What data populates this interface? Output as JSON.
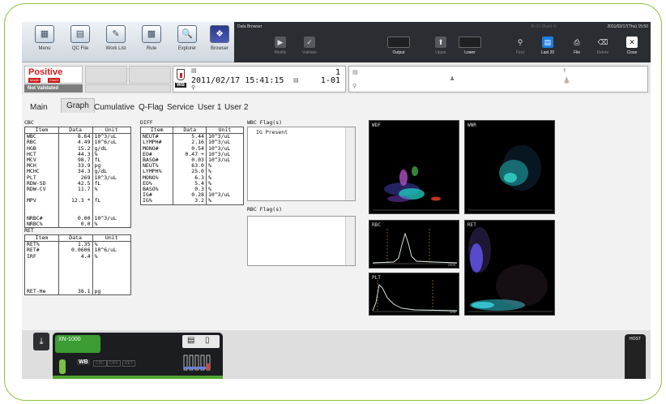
{
  "toolbar": {
    "buttons": [
      {
        "label": "Menu",
        "icon": "menu-icon"
      },
      {
        "label": "QC File",
        "icon": "qc-file-icon"
      },
      {
        "label": "Work List",
        "icon": "work-list-icon"
      },
      {
        "label": "Rule",
        "icon": "rule-icon"
      },
      {
        "label": "Explorer",
        "icon": "explorer-icon"
      },
      {
        "label": "Browser",
        "icon": "browser-icon"
      }
    ]
  },
  "data_browser": {
    "title": "Data Browser",
    "status_right": "2011/02/17(Thu) 15:50",
    "status_mid": "IB-03 (Build 4)",
    "buttons": [
      {
        "label": "Modify",
        "state": "disabled"
      },
      {
        "label": "Validate",
        "state": "disabled"
      },
      {
        "label": "Output",
        "state": "on"
      },
      {
        "label": "Upper",
        "state": "disabled"
      },
      {
        "label": "Lower",
        "state": "on"
      },
      {
        "label": "Find",
        "state": "disabled"
      },
      {
        "label": "Last 20",
        "state": "selected"
      },
      {
        "label": "File",
        "state": "on"
      },
      {
        "label": "Delete",
        "state": "disabled"
      },
      {
        "label": "Close",
        "state": "on"
      }
    ]
  },
  "status": {
    "result": "Positive",
    "tags": [
      "Morph",
      "Count"
    ],
    "validation": "Not Validated"
  },
  "sample": {
    "rack_label": "WB",
    "datetime": "2011/02/17 15:41:15",
    "number_top": "1",
    "number_bottom": "1-01"
  },
  "tabs": [
    "Main",
    "Graph",
    "Cumulative",
    "Q-Flag",
    "Service",
    "User 1",
    "User 2"
  ],
  "active_tab": "Graph",
  "cbc": {
    "title": "CBC",
    "headers": [
      "Item",
      "Data",
      "Unit"
    ],
    "rows": [
      [
        "WBC",
        "8.64",
        "10^3/uL"
      ],
      [
        "RBC",
        "4.49",
        "10^6/uL"
      ],
      [
        "HGB",
        "15.2",
        "g/dL"
      ],
      [
        "HCT",
        "44.3",
        "%"
      ],
      [
        "MCV",
        "98.7",
        "fL"
      ],
      [
        "MCH",
        "33.9",
        "pg"
      ],
      [
        "MCHC",
        "34.3",
        "g/dL"
      ],
      [
        "PLT",
        "269",
        "10^3/uL"
      ],
      [
        "RDW-SD",
        "42.5",
        "fL"
      ],
      [
        "RDW-CV",
        "11.7",
        "%"
      ],
      [
        "",
        "",
        ""
      ],
      [
        "MPV",
        "12.3 *",
        "fL"
      ],
      [
        "",
        "",
        ""
      ],
      [
        "",
        "",
        ""
      ],
      [
        "NRBC#",
        "0.00",
        "10^3/uL"
      ],
      [
        "NRBC%",
        "0.0",
        "%"
      ]
    ]
  },
  "ret": {
    "title": "RET",
    "headers": [
      "Item",
      "Data",
      "Unit"
    ],
    "rows": [
      [
        "RET%",
        "1.35",
        "%"
      ],
      [
        "RET#",
        "0.0606",
        "10^6/uL"
      ],
      [
        "IRF",
        "4.4",
        "%"
      ],
      [
        "",
        "",
        ""
      ],
      [
        "",
        "",
        ""
      ],
      [
        "",
        "",
        ""
      ],
      [
        "",
        "",
        ""
      ],
      [
        "",
        "",
        ""
      ],
      [
        "RET-He",
        "38.1",
        "pg"
      ]
    ]
  },
  "diff": {
    "title": "DIFF",
    "headers": [
      "Item",
      "Data",
      "Unit"
    ],
    "rows": [
      [
        "NEUT#",
        "5.44",
        "10^3/uL"
      ],
      [
        "LYMPH#",
        "2.16",
        "10^3/uL"
      ],
      [
        "MONO#",
        "0.54",
        "10^3/uL"
      ],
      [
        "EO#",
        "0.47 +",
        "10^3/uL"
      ],
      [
        "BASO#",
        "0.03",
        "10^3/uL"
      ],
      [
        "NEUT%",
        "63.0",
        "%"
      ],
      [
        "LYMPH%",
        "25.0",
        "%"
      ],
      [
        "MONO%",
        "6.3",
        "%"
      ],
      [
        "EO%",
        "5.4",
        "%"
      ],
      [
        "BASO%",
        "0.3",
        "%"
      ],
      [
        "IG#",
        "0.28",
        "10^3/uL"
      ],
      [
        "IG%",
        "3.2",
        "%"
      ]
    ]
  },
  "wbc_flags": {
    "title": "WBC Flag(s)",
    "items": [
      "IG Present"
    ]
  },
  "rbc_flags": {
    "title": "RBC Flag(s)",
    "items": []
  },
  "plots": {
    "wdf": "WDF",
    "wnr": "WNR",
    "rbc": "RBC",
    "ret": "RET",
    "plt": "PLT",
    "rbc_axis": "250fL",
    "plt_axis": "40fL"
  },
  "analyzer": {
    "name": "XN-1000",
    "mode": "WB",
    "modes": [
      "CBC",
      "DIFF",
      "RET"
    ],
    "host_label": "HOST"
  },
  "colors": {
    "positive": "#d01c1c",
    "analyzer_green": "#3a9c32",
    "frame_green": "#8cc63f"
  }
}
